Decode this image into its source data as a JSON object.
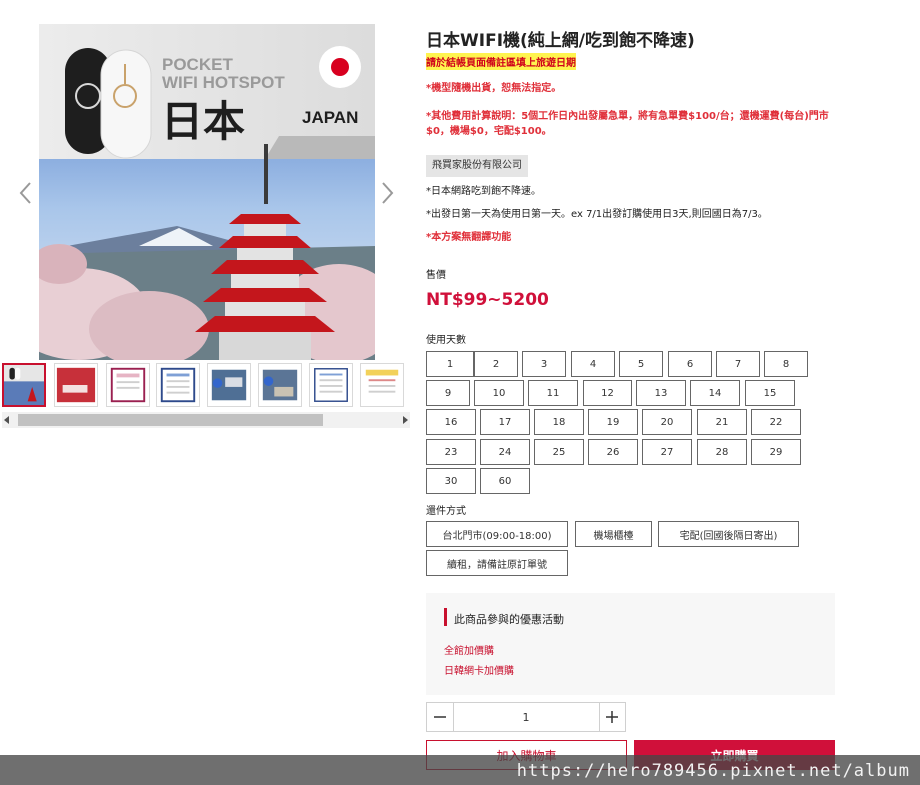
{
  "gallery": {
    "hero": {
      "headline_line1": "POCKET",
      "headline_line2": "WIFI HOTSPOT",
      "country_jp": "日本",
      "country_en": "JAPAN"
    },
    "thumbs": [
      {
        "name": "thumb-1",
        "active": true
      },
      {
        "name": "thumb-2",
        "active": false
      },
      {
        "name": "thumb-3",
        "active": false
      },
      {
        "name": "thumb-4",
        "active": false
      },
      {
        "name": "thumb-5",
        "active": false
      },
      {
        "name": "thumb-6",
        "active": false
      },
      {
        "name": "thumb-7",
        "active": false
      },
      {
        "name": "thumb-8",
        "active": false
      }
    ]
  },
  "product": {
    "title": "日本WIFI機(純上網/吃到飽不降速)",
    "highlight_note": "請於結帳頁面備註區填上旅遊日期",
    "red_note_1": "*機型隨機出貨，恕無法指定。",
    "red_note_2": "*其他費用計算說明：5個工作日內出發屬急單，將有急單費$100/台；還機運費(每台)門市$0，機場$0，宅配$100。",
    "vendor": "飛買家股份有限公司",
    "note_1": "*日本網路吃到飽不降速。",
    "note_2": "*出發日第一天為使用日第一天。ex 7/1出發訂購使用日3天,則回國日為7/3。",
    "red_note_3": "*本方案無翻譯功能",
    "price_label": "售價",
    "price": "NT$99~5200"
  },
  "days": {
    "label": "使用天數",
    "options": [
      "1",
      "2",
      "3",
      "4",
      "5",
      "6",
      "7",
      "8",
      "9",
      "10",
      "11",
      "12",
      "13",
      "14",
      "15",
      "16",
      "17",
      "18",
      "19",
      "20",
      "21",
      "22",
      "23",
      "24",
      "25",
      "26",
      "27",
      "28",
      "29",
      "30",
      "60"
    ]
  },
  "shipping": {
    "label": "還件方式",
    "options": [
      "台北門市(09:00-18:00)",
      "機場櫃檯",
      "宅配(回國後隔日寄出)",
      "續租，請備註原訂單號"
    ]
  },
  "promo": {
    "title": "此商品參與的優惠活動",
    "links": [
      "全館加價購",
      "日韓網卡加價購"
    ]
  },
  "purchase": {
    "quantity": "1",
    "add_to_cart": "加入購物車",
    "buy_now": "立即購買"
  },
  "watermark": "https://hero789456.pixnet.net/album",
  "colors": {
    "accent": "#d0103a",
    "note_red": "#e0303a",
    "highlight": "#fff44f"
  }
}
